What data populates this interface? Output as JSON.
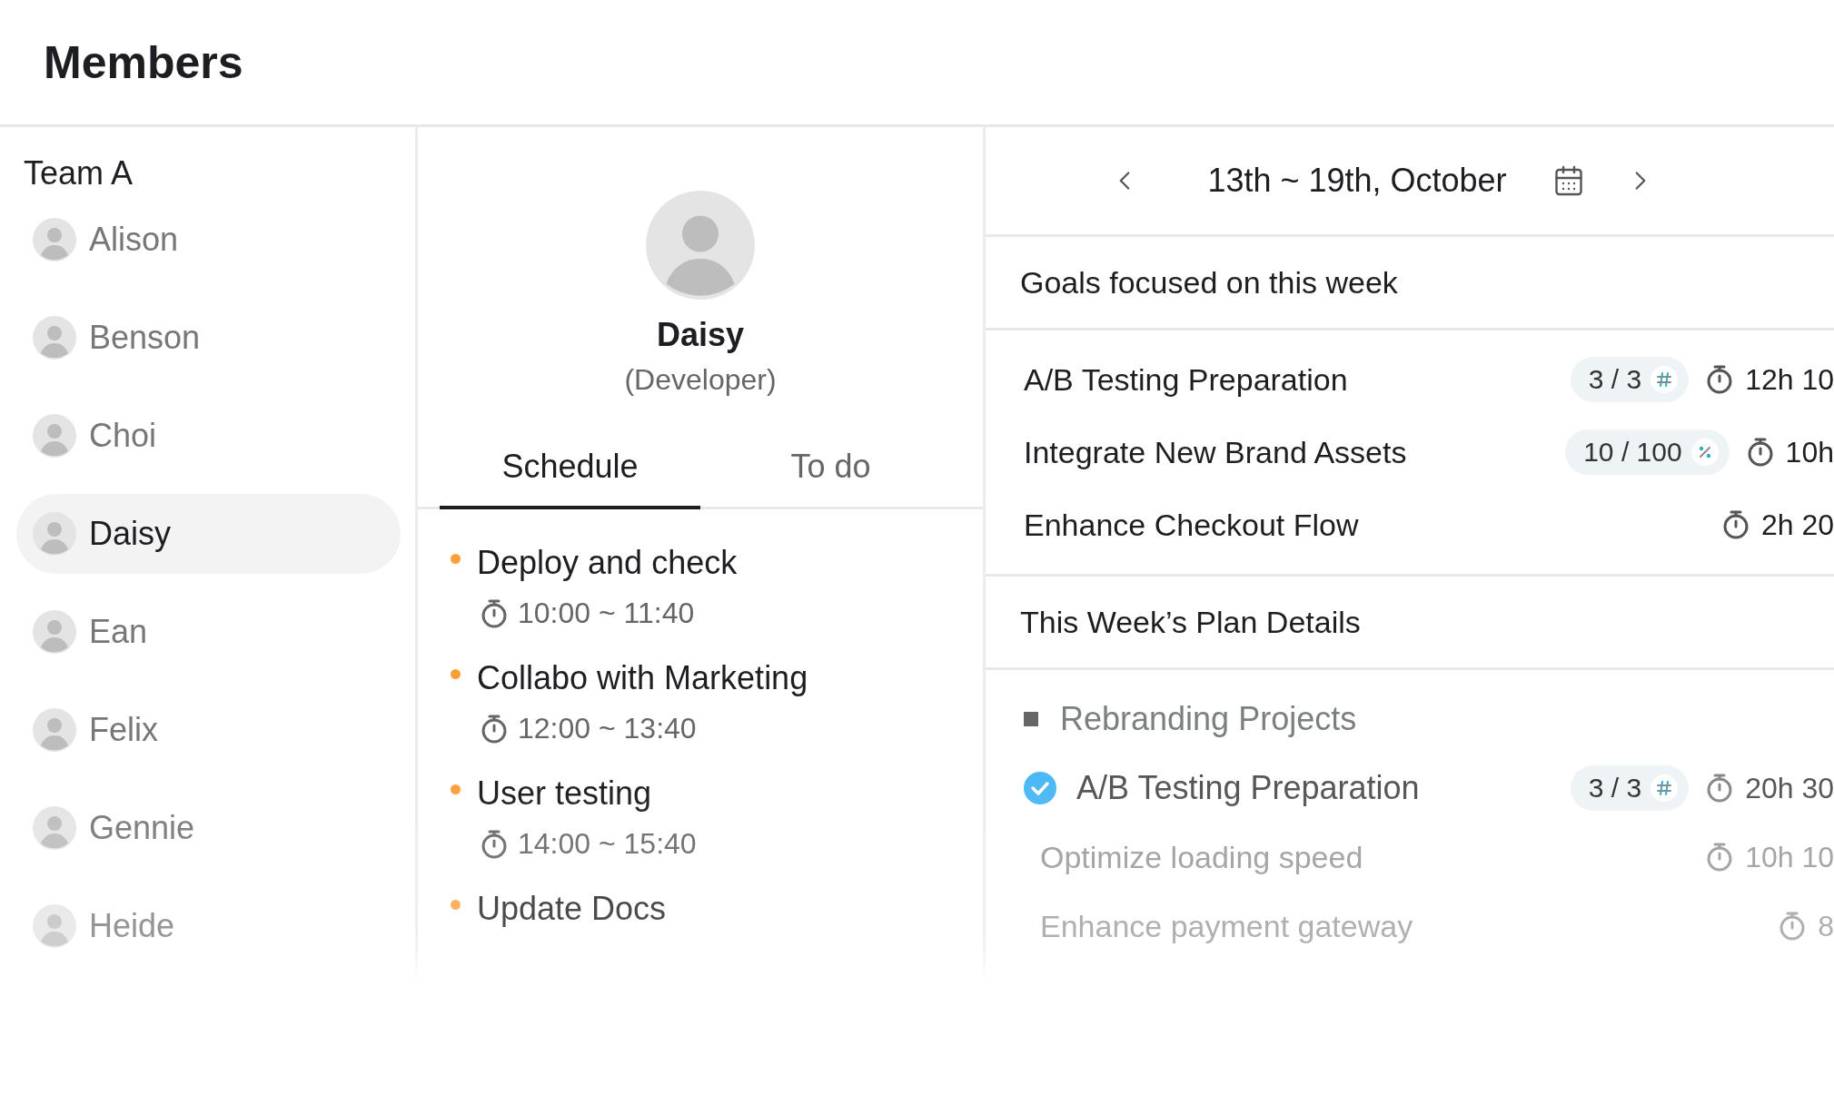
{
  "page": {
    "title": "Members"
  },
  "team": {
    "name": "Team A",
    "members": [
      {
        "name": "Alison",
        "selected": false
      },
      {
        "name": "Benson",
        "selected": false
      },
      {
        "name": "Choi",
        "selected": false
      },
      {
        "name": "Daisy",
        "selected": true
      },
      {
        "name": "Ean",
        "selected": false
      },
      {
        "name": "Felix",
        "selected": false
      },
      {
        "name": "Gennie",
        "selected": false
      },
      {
        "name": "Heide",
        "selected": false
      }
    ]
  },
  "profile": {
    "name": "Daisy",
    "role": "(Developer)"
  },
  "tabs": [
    {
      "label": "Schedule",
      "selected": true
    },
    {
      "label": "To do",
      "selected": false
    }
  ],
  "schedule": [
    {
      "title": "Deploy and check",
      "time": "10:00 ~ 11:40"
    },
    {
      "title": "Collabo with Marketing",
      "time": "12:00 ~ 13:40"
    },
    {
      "title": "User testing",
      "time": "14:00 ~ 15:40"
    },
    {
      "title": "Update Docs"
    }
  ],
  "week": {
    "range": "13th ~ 19th, October"
  },
  "goals": {
    "title": "Goals focused on this week",
    "items": [
      {
        "name": "A/B Testing Preparation",
        "progress": "3 / 3",
        "kind": "count",
        "duration": "12h 10"
      },
      {
        "name": "Integrate New Brand Assets",
        "progress": "10 / 100",
        "kind": "percent",
        "duration": "10h"
      },
      {
        "name": "Enhance Checkout Flow",
        "duration": "2h 20"
      }
    ]
  },
  "plan": {
    "title": "This Week’s Plan Details",
    "groups": [
      {
        "name": "Rebranding Projects",
        "items": [
          {
            "name": "A/B Testing Preparation",
            "checked": true,
            "progress": "3 / 3",
            "kind": "count",
            "duration": "20h 30",
            "children": [
              {
                "name": "Optimize loading speed",
                "duration": "10h 10"
              },
              {
                "name": "Enhance payment gateway",
                "duration": "8"
              }
            ]
          }
        ]
      }
    ]
  }
}
